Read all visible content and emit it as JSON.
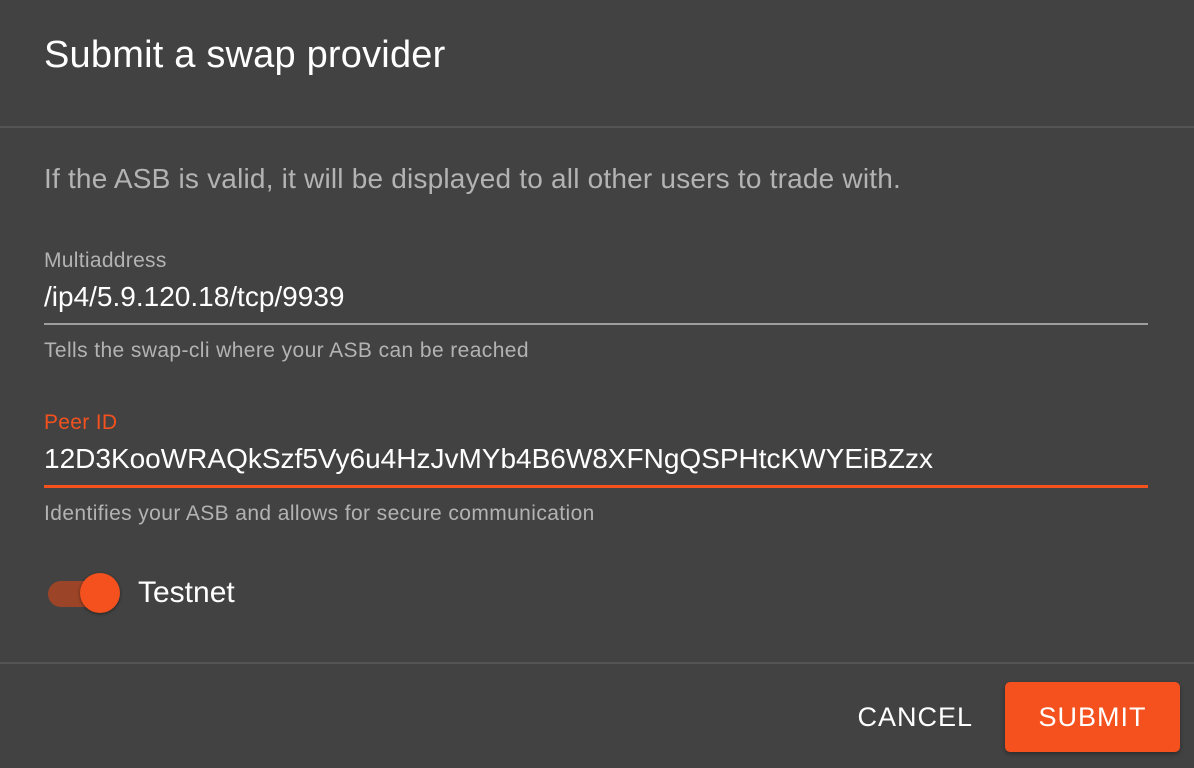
{
  "dialog": {
    "title": "Submit a swap provider",
    "description": "If the ASB is valid, it will be displayed to all other users to trade with."
  },
  "fields": {
    "multiaddress": {
      "label": "Multiaddress",
      "value": "/ip4/5.9.120.18/tcp/9939",
      "helper": "Tells the swap-cli where your ASB can be reached"
    },
    "peer_id": {
      "label": "Peer ID",
      "value": "12D3KooWRAQkSzf5Vy6u4HzJvMYb4B6W8XFNgQSPHtcKWYEiBZzx",
      "helper": "Identifies your ASB and allows for secure communication",
      "focused": true
    }
  },
  "testnet_switch": {
    "label": "Testnet",
    "checked": true
  },
  "actions": {
    "cancel_label": "CANCEL",
    "submit_label": "SUBMIT"
  },
  "colors": {
    "accent": "#f4511e",
    "background": "#424242",
    "secondary_text": "#b3b3b3"
  }
}
